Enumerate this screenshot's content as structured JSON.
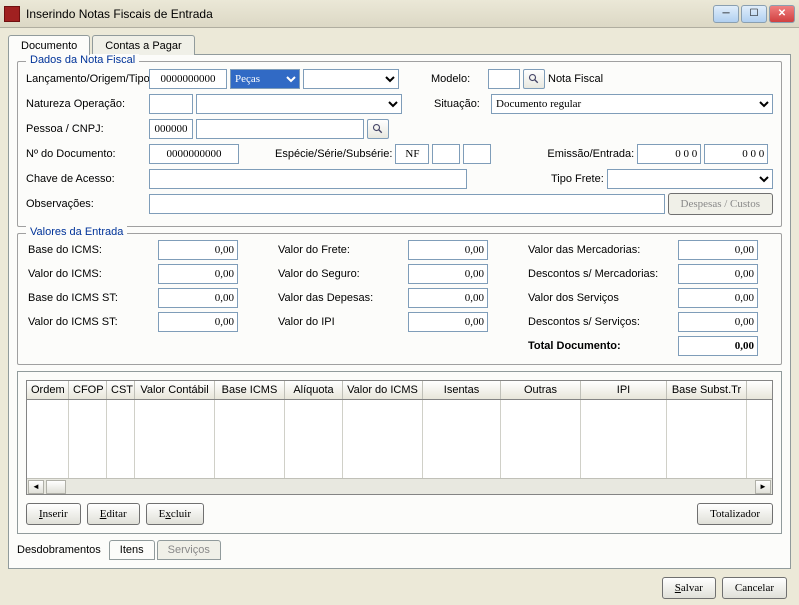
{
  "window": {
    "title": "Inserindo Notas Fiscais de Entrada"
  },
  "tabs": {
    "documento": "Documento",
    "contas": "Contas a Pagar"
  },
  "fiscal": {
    "legend": "Dados da Nota Fiscal",
    "lancamento_label": "Lançamento/Origem/Tipo:",
    "lancamento_value": "0000000000",
    "origem_value": "Peças",
    "tipo_value": "",
    "modelo_label": "Modelo:",
    "modelo_value": "",
    "modelo_text": "Nota Fiscal",
    "natureza_label": "Natureza Operação:",
    "natureza_code": "",
    "natureza_desc": "",
    "situacao_label": "Situação:",
    "situacao_value": "Documento regular",
    "pessoa_label": "Pessoa / CNPJ:",
    "pessoa_code": "000000",
    "pessoa_name": "",
    "numdoc_label": "Nº do Documento:",
    "numdoc_value": "0000000000",
    "especie_label": "Espécie/Série/Subsérie:",
    "especie_value": "NF",
    "serie_value": "",
    "subserie_value": "",
    "emissao_label": "Emissão/Entrada:",
    "emissao_value": "0 0 0",
    "entrada_value": "0 0 0",
    "chave_label": "Chave de Acesso:",
    "chave_value": "",
    "frete_label": "Tipo Frete:",
    "frete_value": "",
    "obs_label": "Observações:",
    "obs_value": "",
    "despesas_btn": "Despesas / Custos"
  },
  "valores": {
    "legend": "Valores da Entrada",
    "base_icms_label": "Base do ICMS:",
    "base_icms": "0,00",
    "valor_icms_label": "Valor do ICMS:",
    "valor_icms": "0,00",
    "base_icms_st_label": "Base do ICMS ST:",
    "base_icms_st": "0,00",
    "valor_icms_st_label": "Valor do ICMS ST:",
    "valor_icms_st": "0,00",
    "valor_frete_label": "Valor do Frete:",
    "valor_frete": "0,00",
    "valor_seguro_label": "Valor do Seguro:",
    "valor_seguro": "0,00",
    "valor_despesas_label": "Valor das Depesas:",
    "valor_despesas": "0,00",
    "valor_ipi_label": "Valor do IPI",
    "valor_ipi": "0,00",
    "valor_merc_label": "Valor das Mercadorias:",
    "valor_merc": "0,00",
    "desc_merc_label": "Descontos s/ Mercadorias:",
    "desc_merc": "0,00",
    "valor_serv_label": "Valor dos Serviços",
    "valor_serv": "0,00",
    "desc_serv_label": "Descontos s/ Serviços:",
    "desc_serv": "0,00",
    "total_label": "Total Documento:",
    "total": "0,00"
  },
  "grid": {
    "headers": [
      "Ordem",
      "CFOP",
      "CST",
      "Valor Contábil",
      "Base ICMS",
      "Alíquota",
      "Valor do ICMS",
      "Isentas",
      "Outras",
      "IPI",
      "Base Subst.Tr"
    ],
    "widths": [
      42,
      38,
      28,
      80,
      70,
      58,
      80,
      78,
      80,
      86,
      80
    ],
    "inserir": "Inserir",
    "editar": "Editar",
    "excluir": "Excluir",
    "totalizador": "Totalizador"
  },
  "subtabs": {
    "label": "Desdobramentos",
    "itens": "Itens",
    "servicos": "Serviços"
  },
  "bottom": {
    "salvar": "Salvar",
    "cancelar": "Cancelar"
  }
}
